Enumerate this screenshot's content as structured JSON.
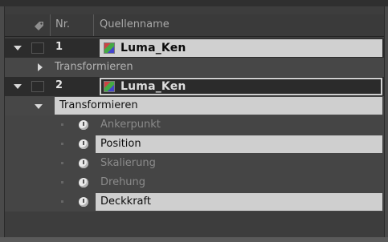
{
  "header": {
    "column_tag_icon": "tag-icon",
    "column_nr": "Nr.",
    "column_source_name": "Quellenname"
  },
  "layers": [
    {
      "number": "1",
      "name": "Luma_Ken",
      "expanded": true,
      "selected": false,
      "group": {
        "label": "Transformieren",
        "expanded": false
      }
    },
    {
      "number": "2",
      "name": "Luma_Ken",
      "expanded": true,
      "selected": true,
      "group": {
        "label": "Transformieren",
        "expanded": true,
        "properties": [
          {
            "label": "Ankerpunkt",
            "highlighted": false
          },
          {
            "label": "Position",
            "highlighted": true
          },
          {
            "label": "Skalierung",
            "highlighted": false
          },
          {
            "label": "Drehung",
            "highlighted": false
          },
          {
            "label": "Deckkraft",
            "highlighted": true
          }
        ]
      }
    }
  ],
  "colors": {
    "panel_bg": "#3d3d3d",
    "row_dark": "#2b2b2b",
    "highlight": "#cfcfcf",
    "text_dim": "#8b8b8b",
    "text_light": "#c9c9c9"
  }
}
